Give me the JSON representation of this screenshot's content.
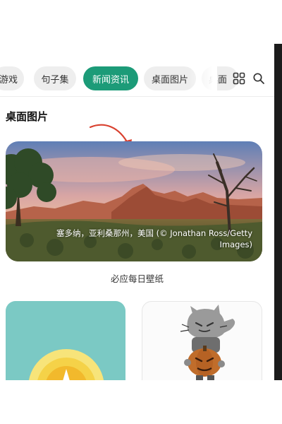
{
  "tabs": [
    {
      "label": "游戏",
      "active": false
    },
    {
      "label": "句子集",
      "active": false
    },
    {
      "label": "新闻资讯",
      "active": true
    },
    {
      "label": "桌面图片",
      "active": false
    },
    {
      "label": "桌面",
      "active": false
    }
  ],
  "icons": {
    "grid": "grid-icon",
    "search": "search-icon",
    "arrow": "red-arrow-annotation"
  },
  "section": {
    "title": "桌面图片"
  },
  "featured": {
    "caption": "塞多纳，亚利桑那州，美国 (© Jonathan Ross/Getty Images)",
    "label": "必应每日壁纸"
  },
  "colors": {
    "accent": "#1c9b78",
    "arrow": "#d9412f"
  }
}
